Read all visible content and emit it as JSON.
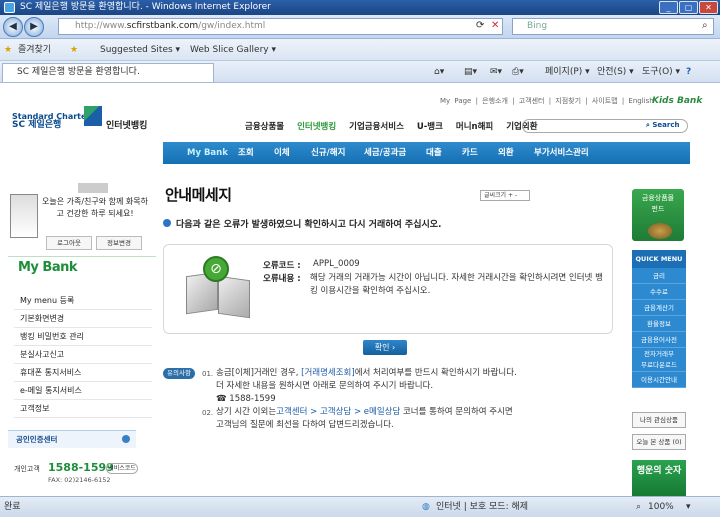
{
  "browser": {
    "title": "SC 제일은행 방문을 환영합니다. - Windows Internet Explorer",
    "url_prefix": "http://www.",
    "url_domain": "scfirstbank.com",
    "url_path": "/gw/index.html",
    "search_placeholder": "Bing",
    "favorites": "즐겨찾기",
    "suggested_sites": "Suggested Sites ▾",
    "web_slice": "Web Slice Gallery ▾",
    "tab_title": "SC 제일은행 방문을 환영합니다.",
    "tools": {
      "page": "페이지(P) ▾",
      "safety": "안전(S) ▾",
      "tools": "도구(O) ▾",
      "help": "?"
    },
    "status_left": "완료",
    "status_zone": "인터넷 | 보호 모드: 해제",
    "zoom": "100%"
  },
  "header": {
    "logo_en": "Standard Chartered",
    "logo_kr": "SC 제일은행",
    "ibank": "인터넷뱅킹",
    "top_links": "My Page | 은행소개 | 고객센터 | 지점찾기 | 사이트맵 | English",
    "kids": "Kids Bank",
    "main_nav": [
      "금융상품몰",
      "인터넷뱅킹",
      "기업금융서비스",
      "U-뱅크",
      "머니n해피",
      "기업외환"
    ],
    "search_btn": "Search"
  },
  "subnav": [
    "My Bank",
    "조회",
    "이체",
    "신규/해지",
    "세금/공과금",
    "대출",
    "카드",
    "외환",
    "부가서비스관리"
  ],
  "sidebar": {
    "greeting": "오늘은 가족/친구와 함께 화목하고 건강한 하루 되세요!",
    "logout": "로그아웃",
    "info_change": "정보변경",
    "section_title": "My Bank",
    "menu": [
      "My menu 등록",
      "기본화면변경",
      "뱅킹 비밀번호 관리",
      "분실사고신고",
      "휴대폰 통지서비스",
      "e-메일 통지서비스",
      "고객정보"
    ],
    "cert_center": "공인인증센터",
    "phone_label": "개인고객",
    "phone": "1588-1599",
    "phone_btn": "서비스코드",
    "fax": "FAX: 02)2146-6152"
  },
  "content": {
    "title": "안내메세지",
    "font_size_ctrl": "글씨크기 + -",
    "error_line": "다음과 같은 오류가 발생하였으니 확인하시고 다시 거래하여 주십시오.",
    "code_label": "오류코드 :",
    "code_value": "APPL_0009",
    "desc_label": "오류내용 :",
    "desc_value": "해당 거래의 거래가능 시간이 아닙니다. 자세한 거래시간을 확인하시려면 인터넷 뱅킹 이용시간을 확인하여 주십시오.",
    "ok_button": "확인 ›",
    "tip_badge": "유의사항",
    "note1_num": "01.",
    "note1_a": "송금[이체]거래인 경우, ",
    "note1_link": "[거래명세조회]",
    "note1_b": "에서 처리여부를 반드시 확인하시기 바랍니다.",
    "note1_c": "더 자세한 내용을 원하시면 아래로 문의하여 주시기 바랍니다.",
    "note1_phone": "☎ 1588-1599",
    "note2_num": "02.",
    "note2_a": "상기 시간 이외는",
    "note2_link": "고객센터 > 고객상담 > e메일상담",
    "note2_b": " 코너를 통하여 문의하여 주시면",
    "note2_c": "고객님의 질문에 최선을 다하여 답변드리겠습니다."
  },
  "right_sidebar": {
    "fund_mall": "금융상품몰",
    "fund": "펀드",
    "quick_menu": "QUICK MENU",
    "quick_items": [
      "금리",
      "수수료",
      "금융계산기",
      "환율정보",
      "금융용어사전",
      "전자거래부\n무료다운로드",
      "이용시간안내"
    ],
    "my_interest": "나의 관심상품",
    "today_view": "오늘 본 상품 (0)",
    "lucky": "행운의 숫자"
  },
  "colors": {
    "accent_green": "#1d8e3a",
    "nav_blue": "#1570b3"
  }
}
